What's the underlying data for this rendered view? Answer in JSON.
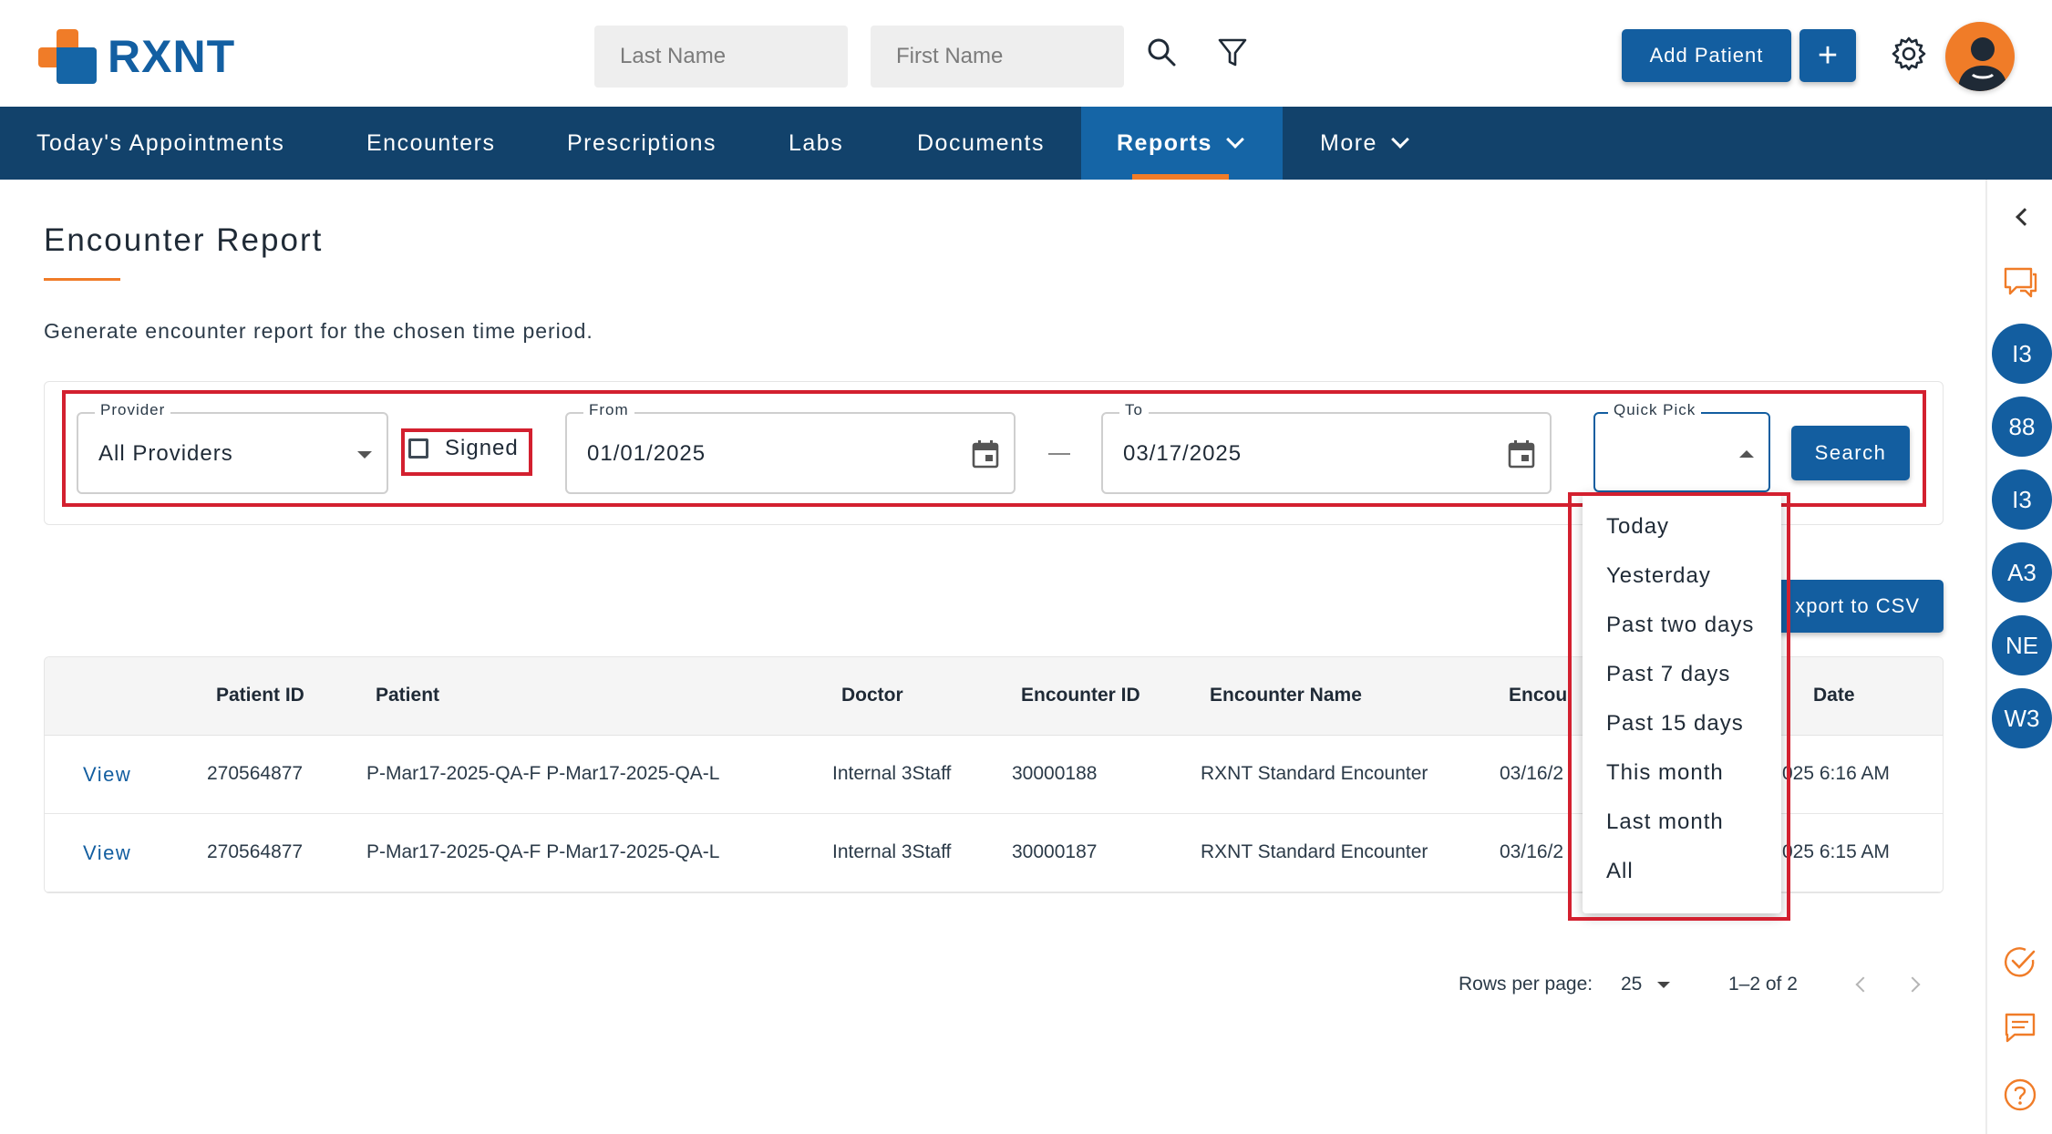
{
  "app": {
    "logo_text": "RXNT"
  },
  "header": {
    "last_name_placeholder": "Last Name",
    "first_name_placeholder": "First Name",
    "add_patient_label": "Add Patient",
    "add_plus_label": "+"
  },
  "nav": {
    "items": [
      {
        "label": "Today's Appointments"
      },
      {
        "label": "Encounters"
      },
      {
        "label": "Prescriptions"
      },
      {
        "label": "Labs"
      },
      {
        "label": "Documents"
      },
      {
        "label": "Reports"
      },
      {
        "label": "More"
      }
    ],
    "active": "Reports"
  },
  "page": {
    "title": "Encounter Report",
    "subtitle": "Generate encounter report for the chosen time period."
  },
  "filters": {
    "provider_label": "Provider",
    "provider_value": "All Providers",
    "signed_label": "Signed",
    "signed_checked": false,
    "from_label": "From",
    "from_value": "01/01/2025",
    "to_label": "To",
    "to_value": "03/17/2025",
    "quick_pick_label": "Quick Pick",
    "search_label": "Search"
  },
  "quick_pick_options": [
    "Today",
    "Yesterday",
    "Past two days",
    "Past 7 days",
    "Past 15 days",
    "This month",
    "Last month",
    "All"
  ],
  "export_label": "xport to CSV",
  "table": {
    "headers": {
      "patient_id": "Patient ID",
      "patient": "Patient",
      "doctor": "Doctor",
      "encounter_id": "Encounter ID",
      "encounter_name": "Encounter Name",
      "encounter_date_partial": "Encou",
      "date_partial": "Date"
    },
    "rows": [
      {
        "action": "View",
        "patient_id": "270564877",
        "patient": "P-Mar17-2025-QA-F P-Mar17-2025-QA-L",
        "doctor": "Internal 3Staff",
        "encounter_id": "30000188",
        "encounter_name": "RXNT Standard Encounter",
        "encounter_date_partial": "03/16/2",
        "date_partial": "025 6:16 AM"
      },
      {
        "action": "View",
        "patient_id": "270564877",
        "patient": "P-Mar17-2025-QA-F P-Mar17-2025-QA-L",
        "doctor": "Internal 3Staff",
        "encounter_id": "30000187",
        "encounter_name": "RXNT Standard Encounter",
        "encounter_date_partial": "03/16/2",
        "date_partial": "025 6:15 AM"
      }
    ]
  },
  "pagination": {
    "rows_per_page_label": "Rows per page:",
    "rows_per_page_value": "25",
    "range_text": "1–2 of 2"
  },
  "rail": {
    "badges": [
      "I3",
      "88",
      "I3",
      "A3",
      "NE",
      "W3"
    ]
  },
  "colors": {
    "brand_blue": "#135ea0",
    "nav_bg": "#12426b",
    "nav_active": "#1565a6",
    "accent_orange": "#f07c28",
    "highlight_red": "#d3202f"
  },
  "icons": {
    "search": "search-icon",
    "filter": "filter-icon",
    "gear": "gear-icon",
    "avatar": "avatar-icon",
    "calendar": "calendar-icon"
  }
}
